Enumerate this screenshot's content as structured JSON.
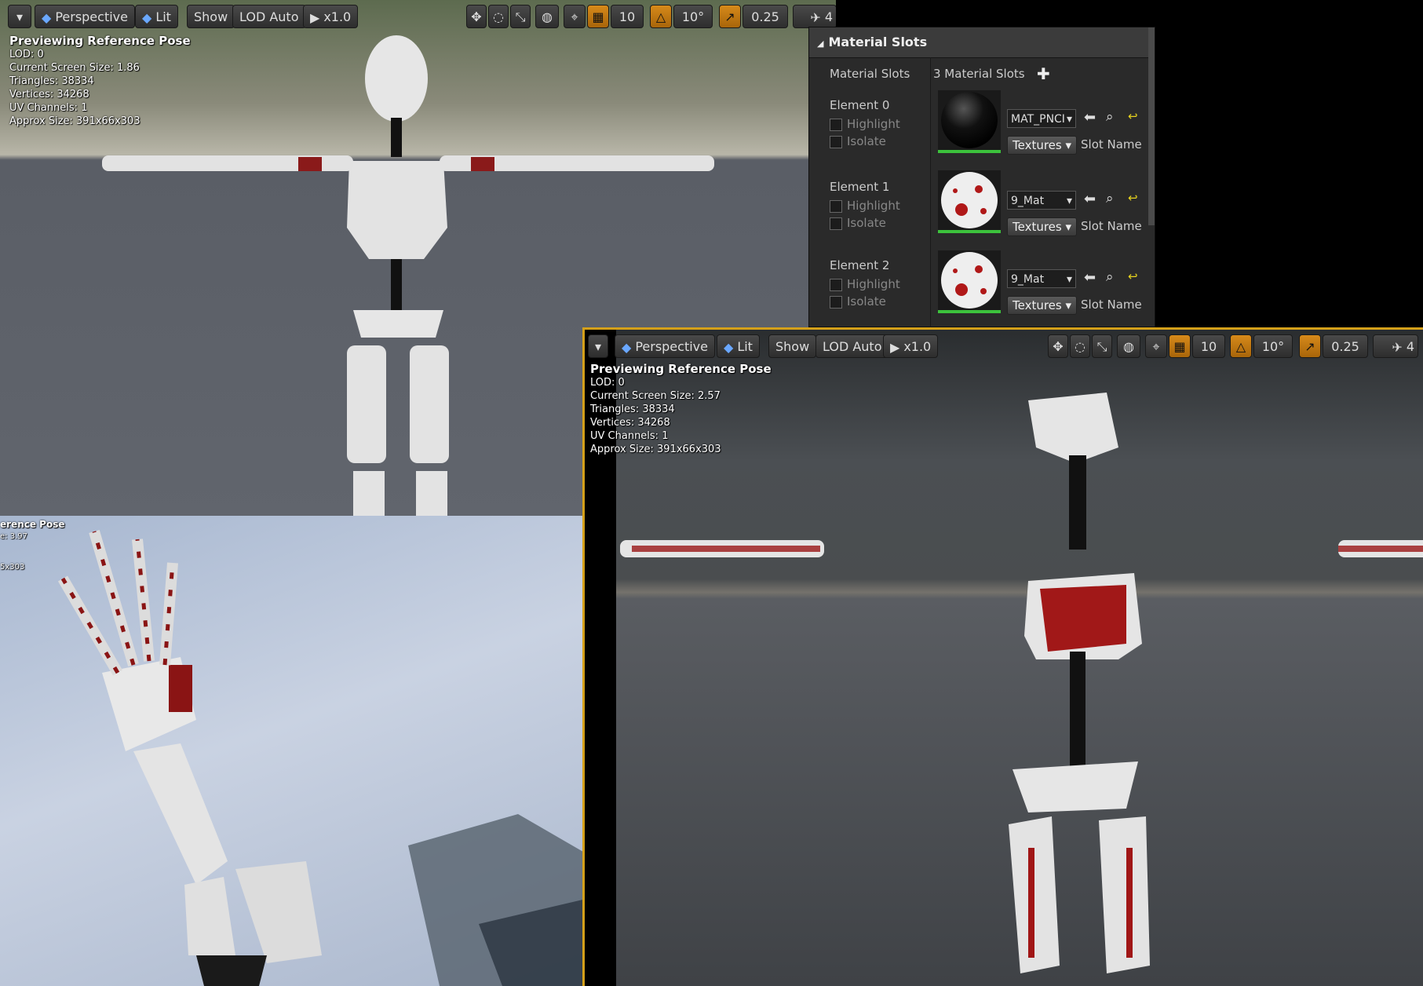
{
  "viewport_tl": {
    "toolbar": {
      "perspective": "Perspective",
      "lit": "Lit",
      "show": "Show",
      "lod": "LOD Auto",
      "speed": "x1.0",
      "grid": "10",
      "angle": "10°",
      "scale": "0.25",
      "cam_speed": "4"
    },
    "info": {
      "title": "Previewing Reference Pose",
      "lines": [
        "LOD: 0",
        "Current Screen Size: 1.86",
        "Triangles: 38334",
        "Vertices: 34268",
        "UV Channels: 1",
        "Approx Size: 391x66x303"
      ]
    }
  },
  "viewport_bl": {
    "info": {
      "title": "erence Pose",
      "lines": [
        "e: 3.97",
        "",
        "",
        "5x303"
      ]
    }
  },
  "viewport_br": {
    "toolbar": {
      "perspective": "Perspective",
      "lit": "Lit",
      "show": "Show",
      "lod": "LOD Auto",
      "speed": "x1.0",
      "grid": "10",
      "angle": "10°",
      "scale": "0.25",
      "cam_speed": "4"
    },
    "info": {
      "title": "Previewing Reference Pose",
      "lines": [
        "LOD: 0",
        "Current Screen Size: 2.57",
        "Triangles: 38334",
        "Vertices: 34268",
        "UV Channels: 1",
        "Approx Size: 391x66x303"
      ]
    }
  },
  "material_panel": {
    "header": "Material Slots",
    "label": "Material Slots",
    "count": "3 Material Slots",
    "elements": [
      {
        "name": "Element 0",
        "highlight": "Highlight",
        "isolate": "Isolate",
        "material": "MAT_PNCI",
        "textures": "Textures",
        "slot": "Slot Name"
      },
      {
        "name": "Element 1",
        "highlight": "Highlight",
        "isolate": "Isolate",
        "material": "9_Mat",
        "textures": "Textures",
        "slot": "Slot Name"
      },
      {
        "name": "Element 2",
        "highlight": "Highlight",
        "isolate": "Isolate",
        "material": "9_Mat",
        "textures": "Textures",
        "slot": "Slot Name"
      }
    ]
  },
  "icons": [
    "dropdown-icon",
    "cube-icon",
    "play-icon",
    "translate-icon",
    "rotate-icon",
    "scale-icon",
    "globe-icon",
    "surface-snap-icon",
    "grid-icon",
    "angle-icon",
    "scale-snap-icon",
    "camera-speed-icon",
    "add-icon",
    "arrow-left-icon",
    "search-icon",
    "reset-icon"
  ]
}
